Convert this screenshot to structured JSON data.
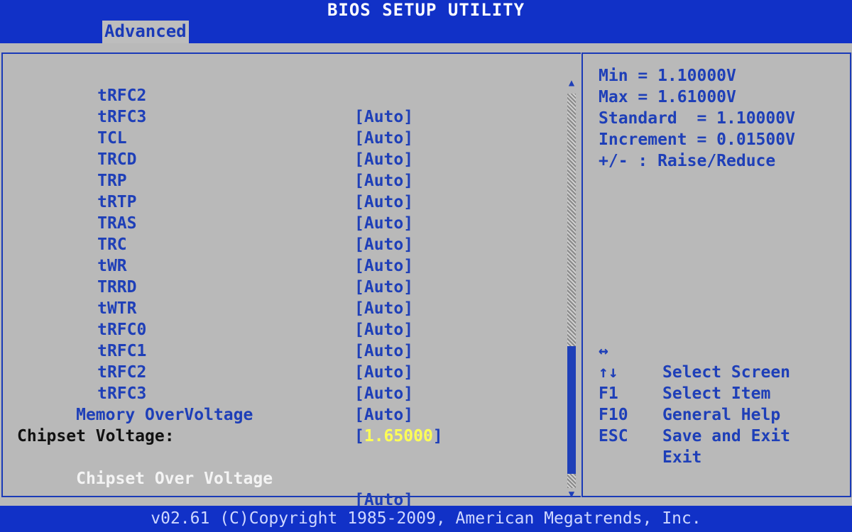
{
  "header": {
    "title": "BIOS SETUP UTILITY"
  },
  "tabs": [
    {
      "label": "Advanced",
      "active": true
    }
  ],
  "options": [
    {
      "name": "tRFC2",
      "value": "[Auto]"
    },
    {
      "name": "tRFC3",
      "value": "[Auto]"
    },
    {
      "name": "TCL",
      "value": "[Auto]"
    },
    {
      "name": "TRCD",
      "value": "[Auto]"
    },
    {
      "name": "TRP",
      "value": "[Auto]"
    },
    {
      "name": "tRTP",
      "value": "[Auto]"
    },
    {
      "name": "TRAS",
      "value": "[Auto]"
    },
    {
      "name": "TRC",
      "value": "[Auto]"
    },
    {
      "name": "tWR",
      "value": "[Auto]"
    },
    {
      "name": "TRRD",
      "value": "[Auto]"
    },
    {
      "name": "tWTR",
      "value": "[Auto]"
    },
    {
      "name": "tRFC0",
      "value": "[Auto]"
    },
    {
      "name": "tRFC1",
      "value": "[Auto]"
    },
    {
      "name": "tRFC2",
      "value": "[Auto]"
    },
    {
      "name": "tRFC3",
      "value": "[Auto]"
    }
  ],
  "memory_overvoltage": {
    "label": "Memory OverVoltage",
    "bracket_open": "[",
    "value": "1.65000",
    "bracket_close": "]"
  },
  "chipset_section": {
    "heading": "Chipset Voltage:"
  },
  "chipset_overvoltage": {
    "label": "Chipset Over Voltage",
    "value": "[Auto]"
  },
  "help": {
    "lines": [
      "Min = 1.10000V",
      "Max = 1.61000V",
      "Standard  = 1.10000V",
      "Increment = 0.01500V",
      "+/- : Raise/Reduce"
    ]
  },
  "keys": [
    {
      "key": "↔",
      "desc": "Select Screen"
    },
    {
      "key": "↑↓",
      "desc": "Select Item"
    },
    {
      "key": "F1",
      "desc": "General Help"
    },
    {
      "key": "F10",
      "desc": "Save and Exit"
    },
    {
      "key": "ESC",
      "desc": "Exit"
    }
  ],
  "scroll": {
    "up": "▲",
    "down": "▼"
  },
  "footer": {
    "text": "v02.61 (C)Copyright 1985-2009, American Megatrends, Inc."
  },
  "colors": {
    "bar_blue": "#1131c7",
    "text_blue": "#1e3fb8",
    "background_gray": "#b9b9b9",
    "highlight_yellow": "#ffff55",
    "selected_white": "#f4f4f4"
  }
}
